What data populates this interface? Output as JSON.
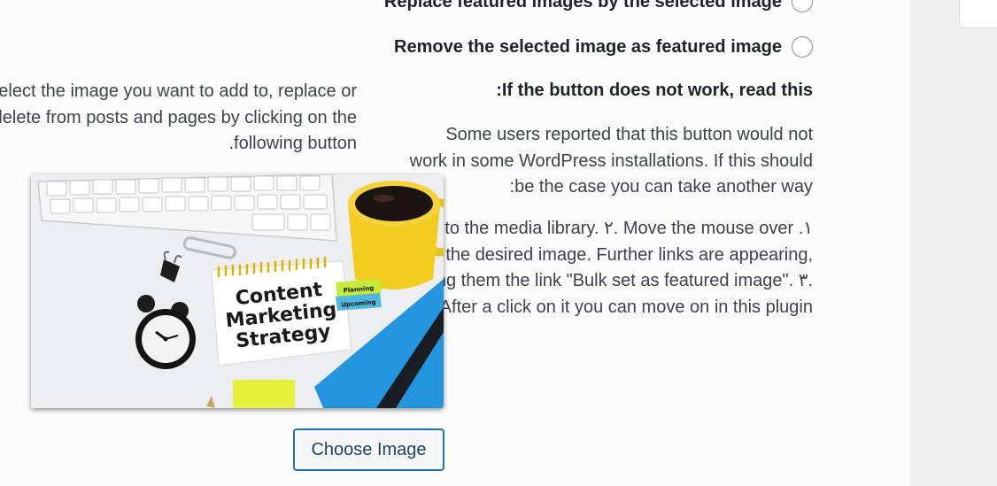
{
  "options": {
    "replace_label": "Replace featured images by the selected image",
    "remove_label": "Remove the selected image as featured image"
  },
  "note": {
    "heading": ":If the button does not work, read this",
    "lines": [
      "Some users reported that this button would not",
      "work in some WordPress installations. If this should",
      ":be the case you can take another way"
    ]
  },
  "steps": {
    "lines": [
      "Go to the media library. ۲. Move the mouse over .۱",
      "the desired image. Further links are appearing,",
      "among them the link \"Bulk set as featured image\". ۳.",
      ".After a click on it you can move on in this plugin"
    ]
  },
  "intro": {
    "lines": [
      "Select the image you want to add to, replace or",
      "delete from posts and pages by clicking on the",
      ".following button"
    ]
  },
  "image": {
    "notebook_text": [
      "Content",
      "Marketing",
      "Strategy"
    ],
    "sticky_labels": [
      "Planning",
      "Upcoming"
    ]
  },
  "button": {
    "choose_label": "Choose Image"
  },
  "colors": {
    "accent": "#2271b1",
    "panel_bg": "#fcfcfc",
    "page_bg": "#f0f0f1"
  }
}
